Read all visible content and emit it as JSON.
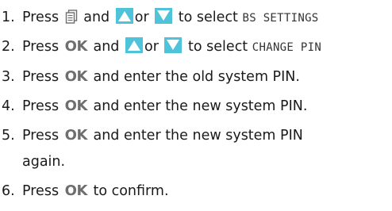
{
  "steps": [
    {
      "number": "1.",
      "text_a": "Press",
      "text_b": "and",
      "text_c": "or",
      "text_d": "to select",
      "display": "BS SETTINGS"
    },
    {
      "number": "2.",
      "text_a": "Press",
      "ok": "OK",
      "text_b": "and",
      "text_c": "or",
      "text_d": "to select",
      "display": "CHANGE PIN"
    },
    {
      "number": "3.",
      "text_a": "Press",
      "ok": "OK",
      "text_b": "and enter the old system PIN."
    },
    {
      "number": "4.",
      "text_a": "Press",
      "ok": "OK",
      "text_b": "and enter the new system PIN."
    },
    {
      "number": "5.",
      "text_a": "Press",
      "ok": "OK",
      "text_b": "and enter the new system PIN",
      "text_c": "again."
    },
    {
      "number": "6.",
      "text_a": "Press",
      "ok": "OK",
      "text_b": "to confirm."
    }
  ],
  "icons": {
    "menu": "menu-icon",
    "up": "up-arrow-icon",
    "down": "down-arrow-icon",
    "arrow_color": "#4fc3d9"
  }
}
